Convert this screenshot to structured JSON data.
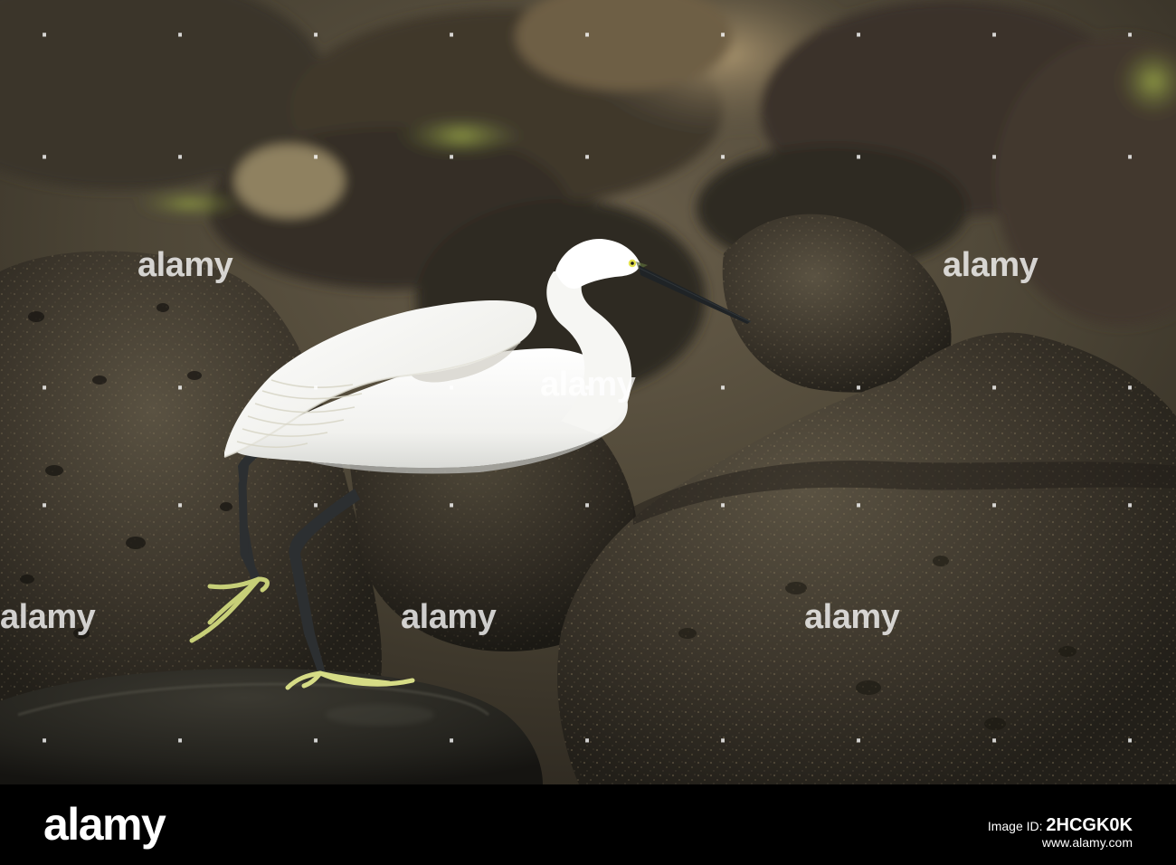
{
  "watermark": {
    "text": "alamy"
  },
  "footer": {
    "logo": "alamy",
    "image_id_label": "Image ID:",
    "image_id": "2HCGK0K",
    "site": "www.alamy.com"
  },
  "palette": {
    "footer_bg": "#000000",
    "rock_dark": "#2b2720",
    "rock_mid": "#4a4438",
    "background_blur": "#5e5544",
    "egret_white": "#f4f4f2",
    "legs": "#2c2f31",
    "feet": "#d6dc86",
    "bill": "#1f2326",
    "eye": "#e2e04c"
  },
  "scene": {
    "subject": "egret-icon",
    "setting": "rocks-icon"
  }
}
